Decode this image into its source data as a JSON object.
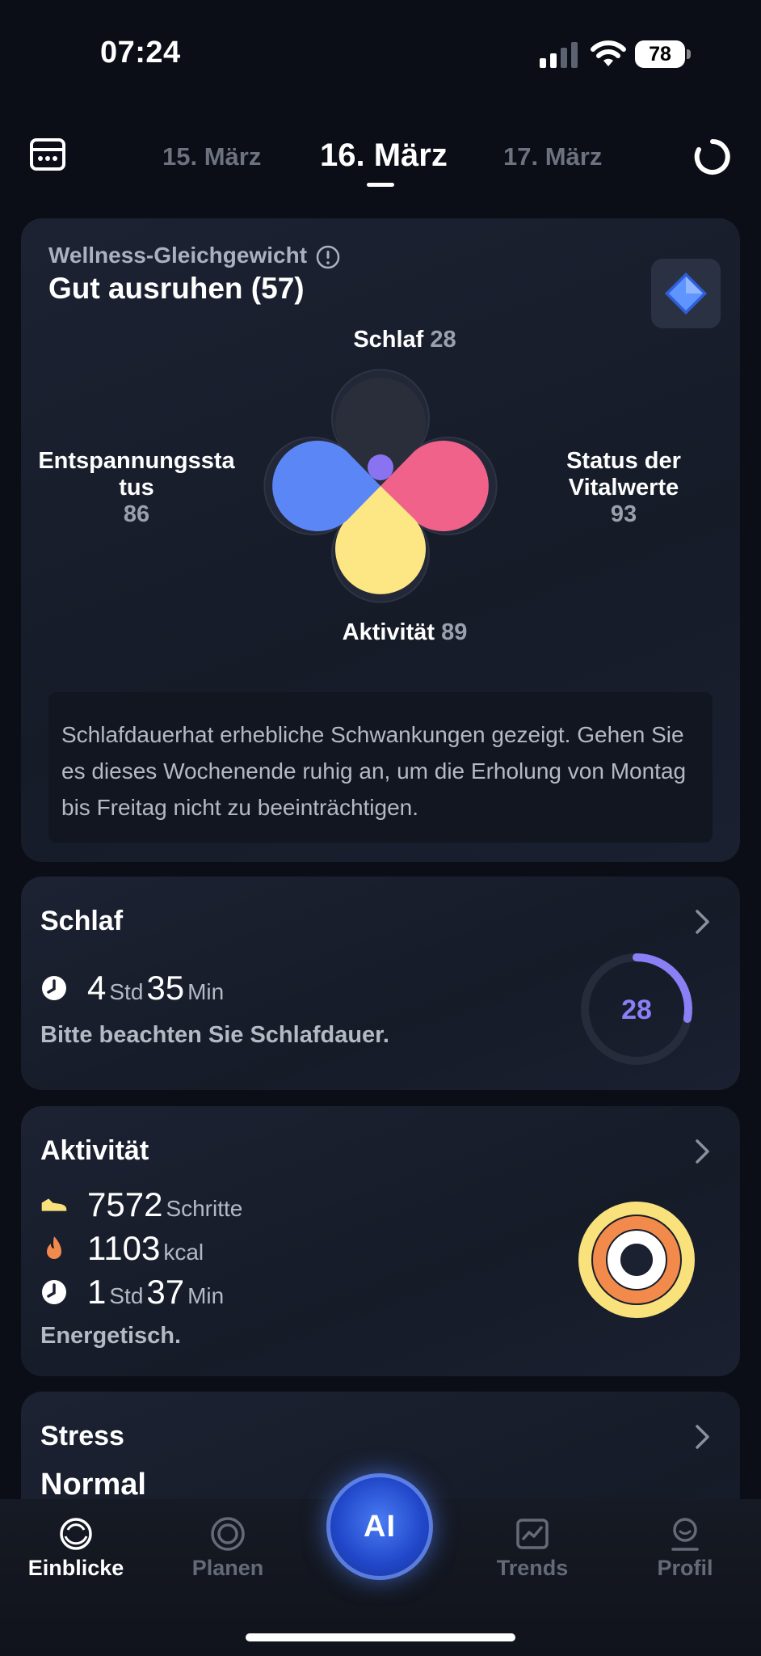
{
  "status_bar": {
    "time": "07:24",
    "battery": "78"
  },
  "date_nav": {
    "prev": "15. März",
    "current": "16. März",
    "next": "17. März"
  },
  "wellness": {
    "label": "Wellness-Gleichgewicht",
    "value": "Gut ausruhen (57)",
    "petals": {
      "top": {
        "label": "Schlaf",
        "value": "28",
        "color": "#2a2e3a"
      },
      "right": {
        "label": "Status der Vitalwerte",
        "value": "93",
        "color": "#f0628a"
      },
      "bottom": {
        "label": "Aktivität",
        "value": "89",
        "color": "#fde684"
      },
      "left": {
        "label": "Entspannungssta tus",
        "value": "86",
        "color": "#5b86f5"
      }
    },
    "center_color": "#8a73f0",
    "advice": "Schlafdauerhat erhebliche Schwankungen gezeigt. Gehen Sie es dieses Wochenende ruhig an, um die Erholung von Montag bis Freitag nicht zu beeinträchtigen."
  },
  "sleep": {
    "title": "Schlaf",
    "hours": "4",
    "hours_unit": "Std",
    "minutes": "35",
    "minutes_unit": "Min",
    "note": "Bitte beachten Sie Schlafdauer.",
    "score": "28",
    "score_fraction": 0.28,
    "ring_color": "#8a80f5"
  },
  "activity": {
    "title": "Aktivität",
    "steps": "7572",
    "steps_unit": "Schritte",
    "kcal": "1103",
    "kcal_unit": "kcal",
    "hours": "1",
    "hours_unit": "Std",
    "minutes": "37",
    "minutes_unit": "Min",
    "note": "Energetisch.",
    "colors": {
      "steps": "#f9e27c",
      "kcal": "#f28a4c",
      "time": "#ffffff"
    }
  },
  "stress": {
    "title": "Stress",
    "value": "Normal"
  },
  "tabs": [
    {
      "label": "Einblicke",
      "icon": "insights-icon",
      "active": true
    },
    {
      "label": "Planen",
      "icon": "plan-icon",
      "active": false
    },
    {
      "label": "Trends",
      "icon": "trends-icon",
      "active": false
    },
    {
      "label": "Profil",
      "icon": "profile-icon",
      "active": false
    }
  ],
  "ai_button": {
    "label": "AI"
  }
}
